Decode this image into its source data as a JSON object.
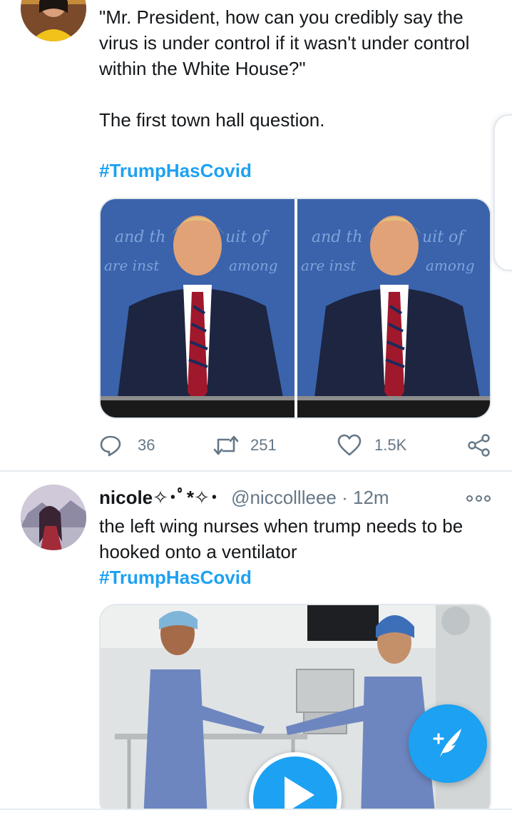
{
  "tweet1": {
    "text": "\"Mr. President, how can you credibly say the virus is under control if it wasn't under control within the White House?\"\n\nThe first town hall question.",
    "hashtag": "#TrumpHasCovid",
    "media": {
      "left_image": "debate-photo",
      "right_image": "debate-photo"
    },
    "actions": {
      "replies": "36",
      "retweets": "251",
      "likes": "1.5K"
    }
  },
  "tweet2": {
    "name": "nicole✧･ﾟ*✧･",
    "handle": "@niccollleee",
    "separator": " · ",
    "time": "12m",
    "text": "the left wing nurses when trump needs to be hooked onto a ventilator",
    "hashtag": "#TrumpHasCovid",
    "media": {
      "type": "video",
      "icon": "play-icon"
    }
  },
  "icons": {
    "reply": "reply-icon",
    "retweet": "retweet-icon",
    "like": "heart-icon",
    "share": "share-icon",
    "more": "more-icon",
    "compose": "compose-tweet-icon"
  },
  "colors": {
    "accent": "#1da1f2",
    "text": "#14171a",
    "secondary": "#657786",
    "divider": "#e6ecf0"
  }
}
